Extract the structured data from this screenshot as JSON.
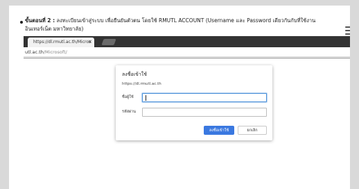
{
  "instruction": {
    "step_label": "ขั้นตอนที่ 2 :",
    "text": "ลงทะเบียนเข้าสู่ระบบ เพื่อยืนยันตัวตน โดยใช้ RMUTL ACCOUNT (Username และ Password เดียวกันกับที่ใช้งานอินเทอร์เน็ต มหาวิทยาลัย)"
  },
  "browser": {
    "tab_title": "https://dl.rmutl.ac.th/Micros",
    "tab_close": "×",
    "url_host": "utl.ac.th",
    "url_path": "/Microsoft/"
  },
  "dialog": {
    "title": "ลงชื่อเข้าใช้",
    "origin": "https://dl.rmutl.ac.th",
    "username_label": "ชื่อผู้ใช้",
    "password_label": "รหัสผ่าน",
    "username_value": "",
    "password_value": "",
    "signin_label": "ลงชื่อเข้าใช้",
    "cancel_label": "ยกเลิก"
  },
  "colors": {
    "primary_button": "#3a78e0",
    "tab_strip": "#333333",
    "focus_ring": "#4a90d9"
  },
  "icons": [
    "menu-icon",
    "tab-close-icon",
    "new-tab-icon"
  ]
}
